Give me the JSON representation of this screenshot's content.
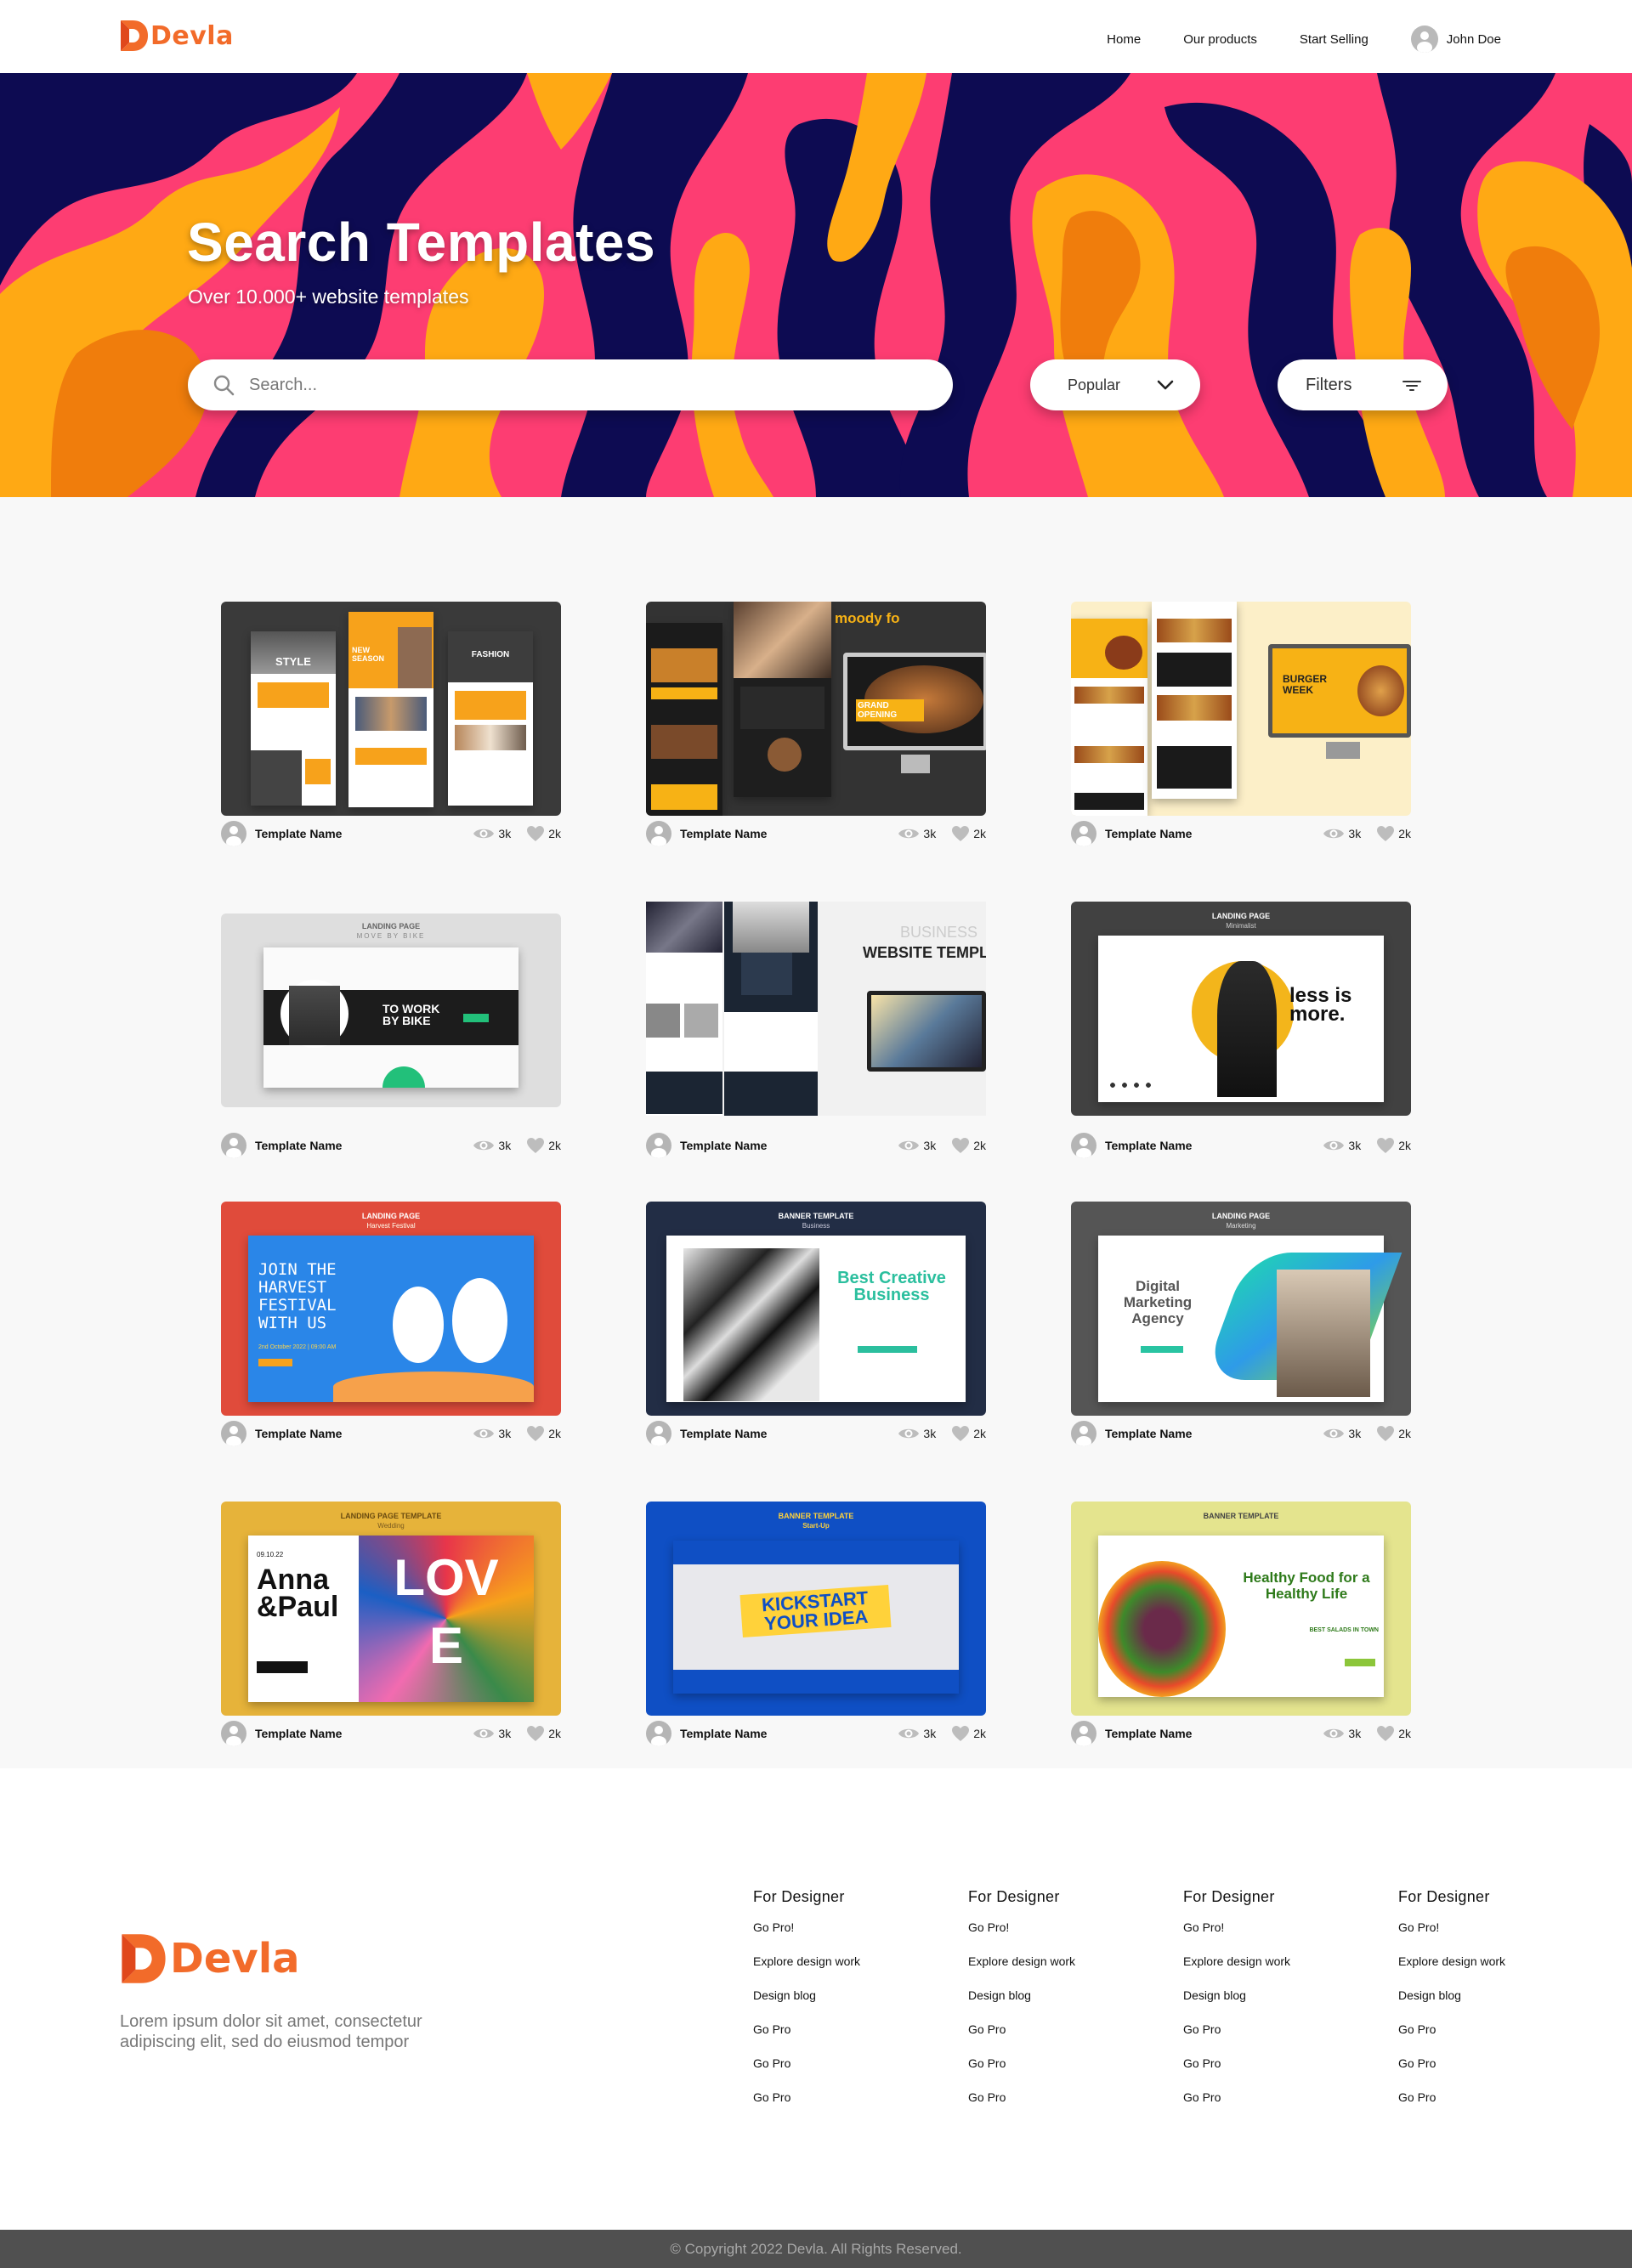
{
  "brand": {
    "name": "Devla",
    "color": "#f26b2a"
  },
  "nav": {
    "links": [
      "Home",
      "Our products",
      "Start Selling"
    ],
    "user_name": "John Doe"
  },
  "hero": {
    "title": "Search Templates",
    "subtitle": "Over 10.000+ website templates",
    "search_placeholder": "Search...",
    "sort_selected": "Popular",
    "filters_label": "Filters",
    "colors": {
      "pink": "#fd3d72",
      "navy": "#0d0b52",
      "orange": "#ffa914",
      "dark_orange": "#f07d0c"
    }
  },
  "cards": [
    {
      "name": "Template Name",
      "views": "3k",
      "likes": "2k",
      "thumb": {
        "bg": "#3a3a3a",
        "top_line": "STYLE",
        "mid_line": "NEW SEASON",
        "right_line": "FASHION"
      }
    },
    {
      "name": "Template Name",
      "views": "3k",
      "likes": "2k",
      "thumb": {
        "bg": "#333333",
        "title": "moody fo",
        "badge": "GRAND OPENING"
      }
    },
    {
      "name": "Template Name",
      "views": "3k",
      "likes": "2k",
      "thumb": {
        "bg": "#fcefc8",
        "badge": "BURGER WEEK"
      }
    },
    {
      "name": "Template Name",
      "views": "3k",
      "likes": "2k",
      "thumb": {
        "bg": "#dedede",
        "title": "LANDING PAGE",
        "subtitle": "MOVE BY BIKE",
        "headline": "TO WORK BY BIKE"
      }
    },
    {
      "name": "Template Name",
      "views": "3k",
      "likes": "2k",
      "thumb": {
        "bg": "#f1f1f1",
        "title": "BUSINESS",
        "headline": "WEBSITE TEMPL"
      }
    },
    {
      "name": "Template Name",
      "views": "3k",
      "likes": "2k",
      "thumb": {
        "bg": "#414141",
        "title": "LANDING PAGE",
        "subtitle": "Minimalist",
        "headline": "less is more."
      }
    },
    {
      "name": "Template Name",
      "views": "3k",
      "likes": "2k",
      "thumb": {
        "bg": "#e04b3b",
        "title": "LANDING PAGE",
        "subtitle": "Harvest Festival",
        "headline": "JOIN THE HARVEST FESTIVAL WITH US",
        "date": "2nd October 2022 | 09:00 AM"
      }
    },
    {
      "name": "Template Name",
      "views": "3k",
      "likes": "2k",
      "thumb": {
        "bg": "#222d45",
        "title": "BANNER TEMPLATE",
        "subtitle": "Business",
        "headline": "Best Creative Business"
      }
    },
    {
      "name": "Template Name",
      "views": "3k",
      "likes": "2k",
      "thumb": {
        "bg": "#555555",
        "title": "LANDING PAGE",
        "subtitle": "Marketing",
        "headline": "Digital Marketing Agency"
      }
    },
    {
      "name": "Template Name",
      "views": "3k",
      "likes": "2k",
      "thumb": {
        "bg": "#e6b33a",
        "title": "LANDING PAGE TEMPLATE",
        "subtitle": "Wedding",
        "date": "09.10.22",
        "headline": "Anna &Paul",
        "art": "LOVE"
      }
    },
    {
      "name": "Template Name",
      "views": "3k",
      "likes": "2k",
      "thumb": {
        "bg": "#0f4fc4",
        "title": "BANNER TEMPLATE",
        "subtitle": "Start-Up",
        "headline": "KICKSTART YOUR IDEA"
      }
    },
    {
      "name": "Template Name",
      "views": "3k",
      "likes": "2k",
      "thumb": {
        "bg": "#e4e48e",
        "title": "BANNER TEMPLATE",
        "headline": "Healthy Food for a Healthy Life",
        "tag": "BEST SALADS IN TOWN"
      }
    }
  ],
  "footer": {
    "description": "Lorem ipsum dolor sit amet, consectetur adipiscing elit, sed do eiusmod tempor",
    "columns": [
      {
        "title": "For Designer",
        "links": [
          "Go Pro!",
          "Explore design work",
          "Design blog",
          "Go Pro",
          "Go Pro",
          "Go Pro"
        ]
      },
      {
        "title": "For Designer",
        "links": [
          "Go Pro!",
          "Explore design work",
          "Design blog",
          "Go Pro",
          "Go Pro",
          "Go Pro"
        ]
      },
      {
        "title": "For Designer",
        "links": [
          "Go Pro!",
          "Explore design work",
          "Design blog",
          "Go Pro",
          "Go Pro",
          "Go Pro"
        ]
      },
      {
        "title": "For Designer",
        "links": [
          "Go Pro!",
          "Explore design work",
          "Design blog",
          "Go Pro",
          "Go Pro",
          "Go Pro"
        ]
      }
    ],
    "copyright": "© Copyright 2022 Devla. All Rights Reserved."
  }
}
